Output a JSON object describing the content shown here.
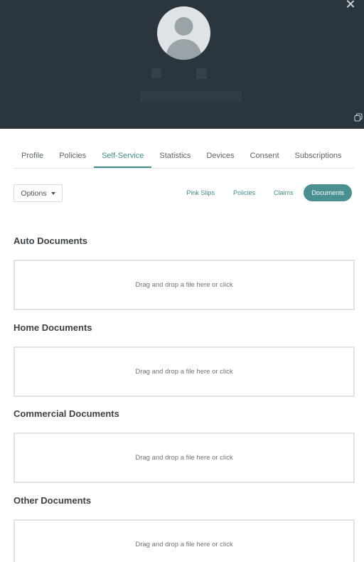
{
  "header": {
    "close_icon": "close-icon",
    "avatar_icon": "user-silhouette-icon",
    "expand_icon": "expand-icon"
  },
  "tabs": [
    {
      "label": "Profile",
      "active": false
    },
    {
      "label": "Policies",
      "active": false
    },
    {
      "label": "Self-Service",
      "active": true
    },
    {
      "label": "Statistics",
      "active": false
    },
    {
      "label": "Devices",
      "active": false
    },
    {
      "label": "Consent",
      "active": false
    },
    {
      "label": "Subscriptions",
      "active": false
    }
  ],
  "options": {
    "label": "Options"
  },
  "pills": [
    {
      "label": "Pink Slips",
      "active": false
    },
    {
      "label": "Policies",
      "active": false
    },
    {
      "label": "Claims",
      "active": false
    },
    {
      "label": "Documents",
      "active": true
    }
  ],
  "sections": [
    {
      "title": "Auto Documents",
      "dropzone_text": "Drag and drop a file here or click"
    },
    {
      "title": "Home Documents",
      "dropzone_text": "Drag and drop a file here or click"
    },
    {
      "title": "Commercial Documents",
      "dropzone_text": "Drag and drop a file here or click"
    },
    {
      "title": "Other Documents",
      "dropzone_text": "Drag and drop a file here or click"
    }
  ],
  "colors": {
    "header_bg": "#2b353d",
    "accent": "#3f8c8c",
    "pill_active_bg": "#4a9091"
  }
}
